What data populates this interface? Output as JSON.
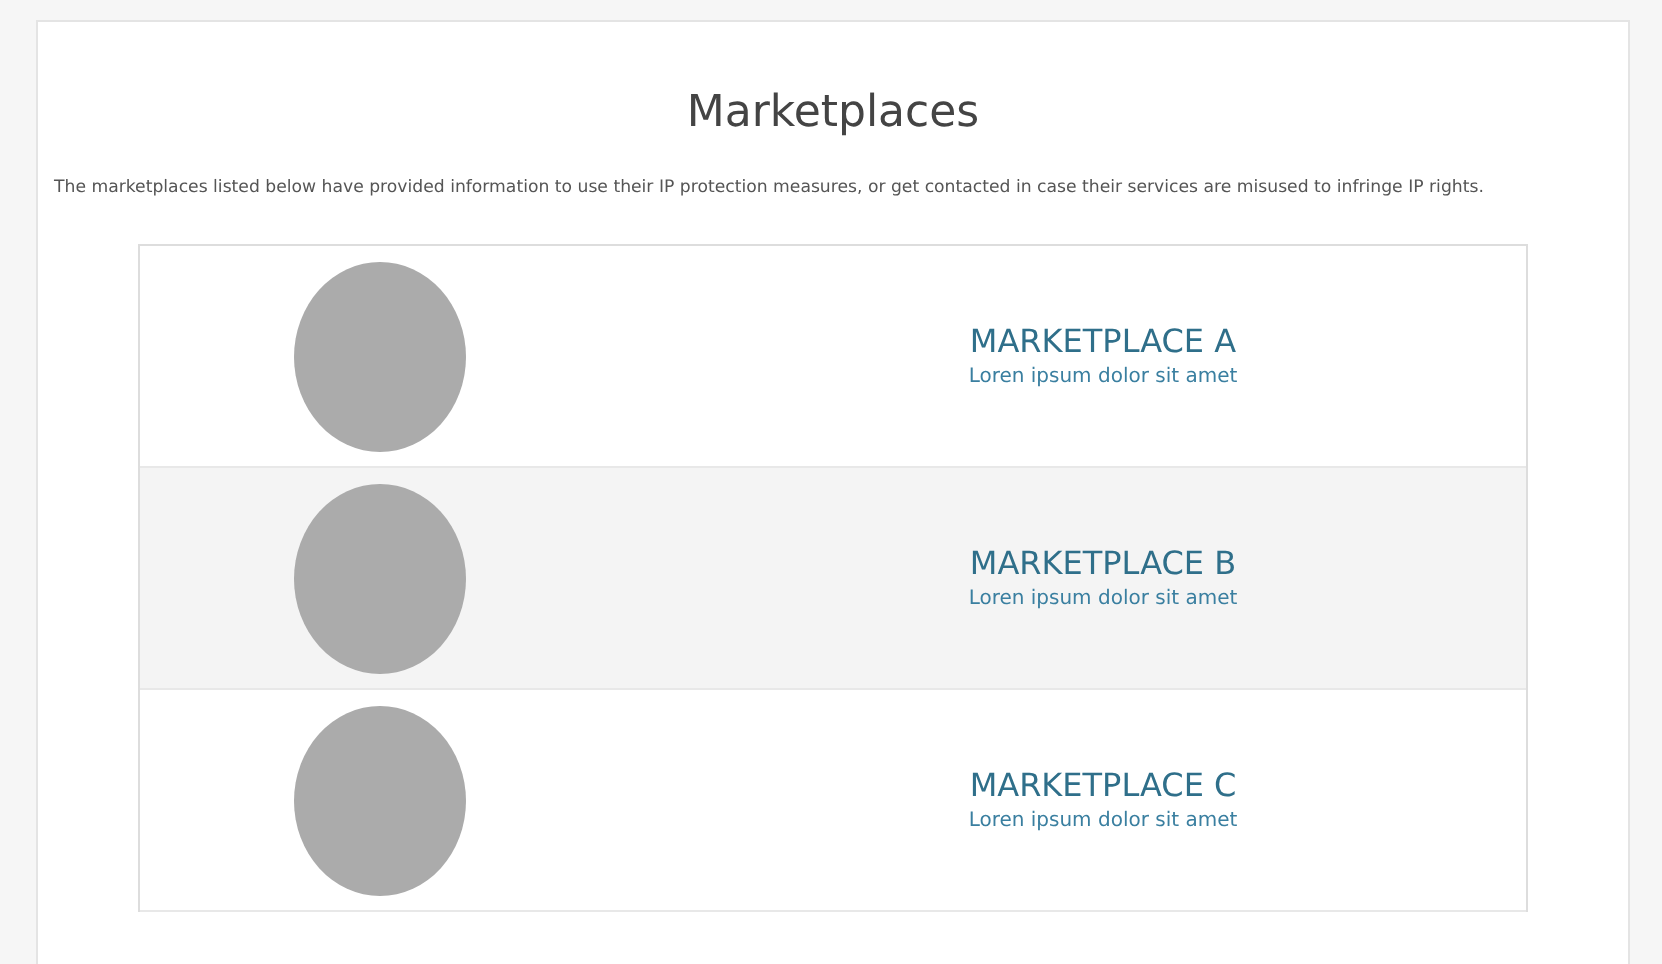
{
  "title": "Marketplaces",
  "description": "The marketplaces listed below have provided information to use their IP protection measures, or get contacted in case their services are misused to infringe IP rights.",
  "marketplaces": [
    {
      "name": "MARKETPLACE A",
      "subtitle": "Loren ipsum dolor sit amet"
    },
    {
      "name": "MARKETPLACE B",
      "subtitle": "Loren ipsum dolor sit amet"
    },
    {
      "name": "MARKETPLACE C",
      "subtitle": "Loren ipsum dolor sit amet"
    }
  ]
}
